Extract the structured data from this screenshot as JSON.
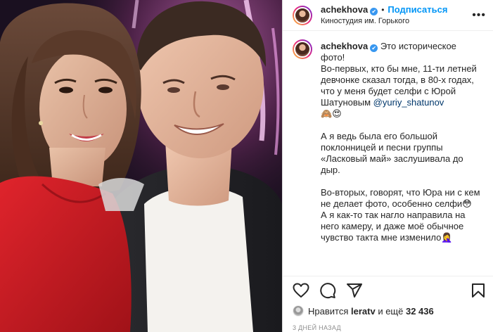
{
  "header": {
    "username": "achekhova",
    "verified_mark": "✔",
    "separator": "•",
    "follow_label": "Подписаться",
    "location": "Киностудия им. Горького",
    "more_icon": "more-dots-icon",
    "more_label": "•••"
  },
  "caption": {
    "username": "achekhova",
    "verified_mark": "✔",
    "p1_text": "Это историческое фото!",
    "p2_text": "Во-первых, кто бы мне, 11-ти летней девчонке сказал тогда, в 80-х годах, что у меня будет селфи с Юрой Шатуновым ",
    "mention": "@yuriy_shatunov",
    "p2_emoji": "🙈😍",
    "p3_text": "А я ведь была его большой поклонницей и песни группы «Ласковый май» заслушивала до дыр.",
    "p4_text": "Во-вторых, говорят, что Юра ни с кем не делает фото, особенно селфи😳",
    "p5_text": "А я как-то так нагло направила на него камеру, и даже моё обычное чувство такта мне изменило🤦‍♀️"
  },
  "actions": {
    "icons": [
      "heart-icon",
      "comment-icon",
      "share-icon",
      "bookmark-icon"
    ],
    "likes_prefix": "Нравится",
    "likes_user": "leratv",
    "likes_middle": "и ещё",
    "likes_count": "32 436",
    "timestamp": "3 ДНЕЙ НАЗАД"
  },
  "colors": {
    "link_blue": "#0095f6",
    "mention_blue": "#00376b",
    "border": "#dbdbdb",
    "muted": "#8e8e8e"
  }
}
